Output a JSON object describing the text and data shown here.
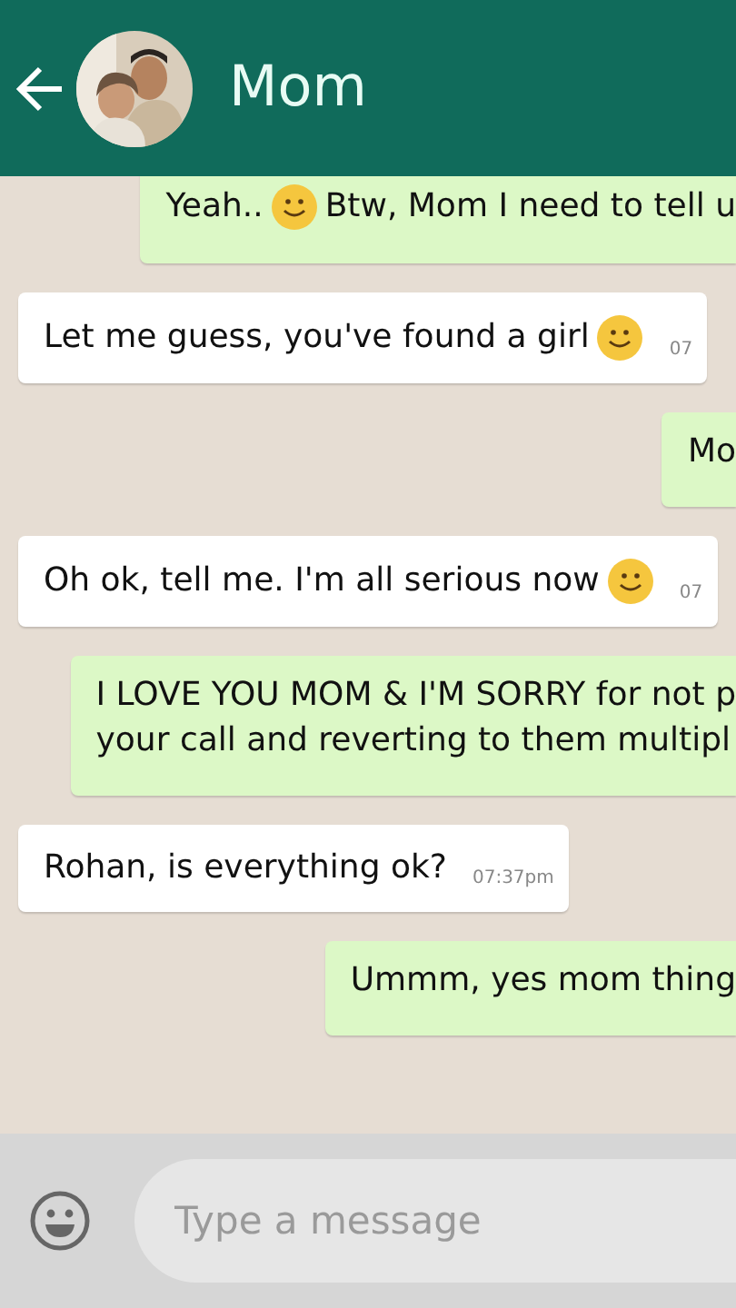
{
  "header": {
    "title": "Mom"
  },
  "messages": [
    {
      "kind": "outgoing",
      "parts": [
        {
          "kind": "text",
          "text": "Yeah.."
        },
        {
          "kind": "emoji"
        },
        {
          "kind": "text",
          "text": "Btw, Mom I need to tell u"
        }
      ]
    },
    {
      "kind": "incoming",
      "parts": [
        {
          "kind": "text",
          "text": "Let me guess, you've found a girl"
        },
        {
          "kind": "emoji"
        }
      ],
      "time": "07"
    },
    {
      "kind": "outgoing",
      "parts": [
        {
          "kind": "text",
          "text": "Mo"
        }
      ]
    },
    {
      "kind": "incoming",
      "parts": [
        {
          "kind": "text",
          "text": "Oh ok, tell me. I'm all serious now"
        },
        {
          "kind": "emoji"
        }
      ],
      "time": "07"
    },
    {
      "kind": "outgoing",
      "parts": [
        {
          "kind": "text",
          "text": "I LOVE YOU MOM & I'M SORRY for not p"
        },
        {
          "kind": "break"
        },
        {
          "kind": "text",
          "text": "your call and reverting to them multipl"
        }
      ]
    },
    {
      "kind": "incoming",
      "parts": [
        {
          "kind": "text",
          "text": "Rohan, is everything ok?"
        }
      ],
      "time": "07:37pm"
    },
    {
      "kind": "outgoing",
      "parts": [
        {
          "kind": "text",
          "text": "Ummm, yes mom thing"
        }
      ]
    }
  ],
  "composer": {
    "placeholder": "Type a message"
  }
}
